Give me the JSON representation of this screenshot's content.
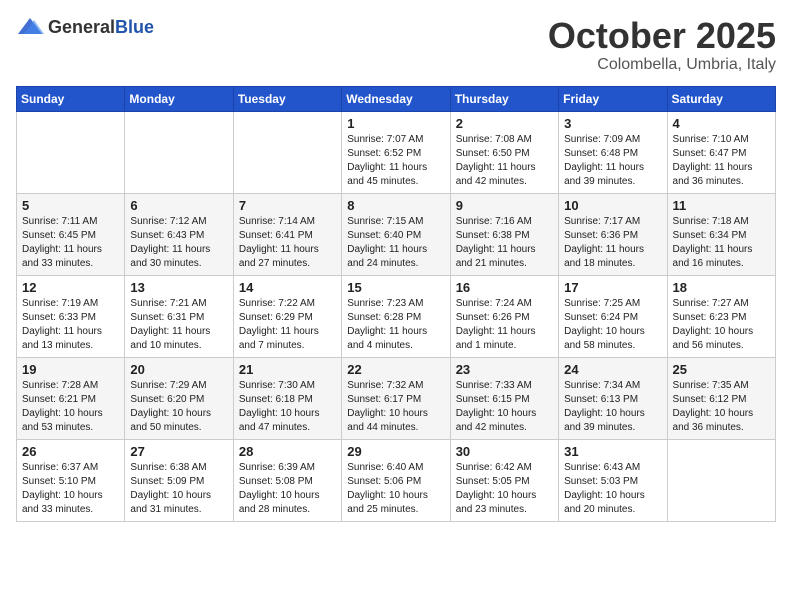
{
  "header": {
    "logo_general": "General",
    "logo_blue": "Blue",
    "month": "October 2025",
    "location": "Colombella, Umbria, Italy"
  },
  "days_of_week": [
    "Sunday",
    "Monday",
    "Tuesday",
    "Wednesday",
    "Thursday",
    "Friday",
    "Saturday"
  ],
  "weeks": [
    [
      {
        "day": "",
        "info": ""
      },
      {
        "day": "",
        "info": ""
      },
      {
        "day": "",
        "info": ""
      },
      {
        "day": "1",
        "info": "Sunrise: 7:07 AM\nSunset: 6:52 PM\nDaylight: 11 hours and 45 minutes."
      },
      {
        "day": "2",
        "info": "Sunrise: 7:08 AM\nSunset: 6:50 PM\nDaylight: 11 hours and 42 minutes."
      },
      {
        "day": "3",
        "info": "Sunrise: 7:09 AM\nSunset: 6:48 PM\nDaylight: 11 hours and 39 minutes."
      },
      {
        "day": "4",
        "info": "Sunrise: 7:10 AM\nSunset: 6:47 PM\nDaylight: 11 hours and 36 minutes."
      }
    ],
    [
      {
        "day": "5",
        "info": "Sunrise: 7:11 AM\nSunset: 6:45 PM\nDaylight: 11 hours and 33 minutes."
      },
      {
        "day": "6",
        "info": "Sunrise: 7:12 AM\nSunset: 6:43 PM\nDaylight: 11 hours and 30 minutes."
      },
      {
        "day": "7",
        "info": "Sunrise: 7:14 AM\nSunset: 6:41 PM\nDaylight: 11 hours and 27 minutes."
      },
      {
        "day": "8",
        "info": "Sunrise: 7:15 AM\nSunset: 6:40 PM\nDaylight: 11 hours and 24 minutes."
      },
      {
        "day": "9",
        "info": "Sunrise: 7:16 AM\nSunset: 6:38 PM\nDaylight: 11 hours and 21 minutes."
      },
      {
        "day": "10",
        "info": "Sunrise: 7:17 AM\nSunset: 6:36 PM\nDaylight: 11 hours and 18 minutes."
      },
      {
        "day": "11",
        "info": "Sunrise: 7:18 AM\nSunset: 6:34 PM\nDaylight: 11 hours and 16 minutes."
      }
    ],
    [
      {
        "day": "12",
        "info": "Sunrise: 7:19 AM\nSunset: 6:33 PM\nDaylight: 11 hours and 13 minutes."
      },
      {
        "day": "13",
        "info": "Sunrise: 7:21 AM\nSunset: 6:31 PM\nDaylight: 11 hours and 10 minutes."
      },
      {
        "day": "14",
        "info": "Sunrise: 7:22 AM\nSunset: 6:29 PM\nDaylight: 11 hours and 7 minutes."
      },
      {
        "day": "15",
        "info": "Sunrise: 7:23 AM\nSunset: 6:28 PM\nDaylight: 11 hours and 4 minutes."
      },
      {
        "day": "16",
        "info": "Sunrise: 7:24 AM\nSunset: 6:26 PM\nDaylight: 11 hours and 1 minute."
      },
      {
        "day": "17",
        "info": "Sunrise: 7:25 AM\nSunset: 6:24 PM\nDaylight: 10 hours and 58 minutes."
      },
      {
        "day": "18",
        "info": "Sunrise: 7:27 AM\nSunset: 6:23 PM\nDaylight: 10 hours and 56 minutes."
      }
    ],
    [
      {
        "day": "19",
        "info": "Sunrise: 7:28 AM\nSunset: 6:21 PM\nDaylight: 10 hours and 53 minutes."
      },
      {
        "day": "20",
        "info": "Sunrise: 7:29 AM\nSunset: 6:20 PM\nDaylight: 10 hours and 50 minutes."
      },
      {
        "day": "21",
        "info": "Sunrise: 7:30 AM\nSunset: 6:18 PM\nDaylight: 10 hours and 47 minutes."
      },
      {
        "day": "22",
        "info": "Sunrise: 7:32 AM\nSunset: 6:17 PM\nDaylight: 10 hours and 44 minutes."
      },
      {
        "day": "23",
        "info": "Sunrise: 7:33 AM\nSunset: 6:15 PM\nDaylight: 10 hours and 42 minutes."
      },
      {
        "day": "24",
        "info": "Sunrise: 7:34 AM\nSunset: 6:13 PM\nDaylight: 10 hours and 39 minutes."
      },
      {
        "day": "25",
        "info": "Sunrise: 7:35 AM\nSunset: 6:12 PM\nDaylight: 10 hours and 36 minutes."
      }
    ],
    [
      {
        "day": "26",
        "info": "Sunrise: 6:37 AM\nSunset: 5:10 PM\nDaylight: 10 hours and 33 minutes."
      },
      {
        "day": "27",
        "info": "Sunrise: 6:38 AM\nSunset: 5:09 PM\nDaylight: 10 hours and 31 minutes."
      },
      {
        "day": "28",
        "info": "Sunrise: 6:39 AM\nSunset: 5:08 PM\nDaylight: 10 hours and 28 minutes."
      },
      {
        "day": "29",
        "info": "Sunrise: 6:40 AM\nSunset: 5:06 PM\nDaylight: 10 hours and 25 minutes."
      },
      {
        "day": "30",
        "info": "Sunrise: 6:42 AM\nSunset: 5:05 PM\nDaylight: 10 hours and 23 minutes."
      },
      {
        "day": "31",
        "info": "Sunrise: 6:43 AM\nSunset: 5:03 PM\nDaylight: 10 hours and 20 minutes."
      },
      {
        "day": "",
        "info": ""
      }
    ]
  ]
}
